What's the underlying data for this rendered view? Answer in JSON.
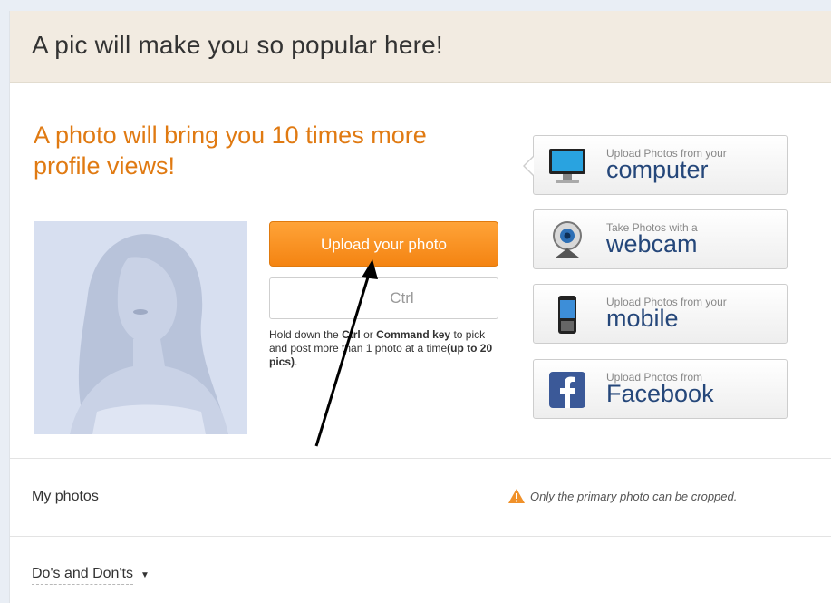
{
  "header": {
    "title": "A pic will make you so popular here!"
  },
  "main": {
    "headline": "A photo will bring you 10 times more profile views!",
    "upload_button": "Upload your photo",
    "ctrl_field": "Ctrl",
    "hint": {
      "part1": "Hold down the ",
      "ctrl": "Ctrl",
      "part2": " or ",
      "command": "Command key",
      "part3": " to pick and post more than 1 photo at a time",
      "limit": "(up to 20 pics)",
      "end": "."
    }
  },
  "upload_options": [
    {
      "small": "Upload Photos from your",
      "big": "computer",
      "icon": "computer-icon"
    },
    {
      "small": "Take Photos with a",
      "big": "webcam",
      "icon": "webcam-icon"
    },
    {
      "small": "Upload Photos from your",
      "big": "mobile",
      "icon": "mobile-icon"
    },
    {
      "small": "Upload Photos from",
      "big": "Facebook",
      "icon": "facebook-icon"
    }
  ],
  "my_photos": {
    "label": "My photos",
    "note": "Only the primary photo can be cropped.",
    "note_icon": "warning-icon"
  },
  "dos_donts": {
    "label": "Do's and Don'ts",
    "icon": "caret-down-icon"
  },
  "colors": {
    "accent_orange": "#f48412",
    "headline_orange": "#e07a12",
    "link_blue": "#25477a",
    "header_bg": "#f2ebe1"
  }
}
